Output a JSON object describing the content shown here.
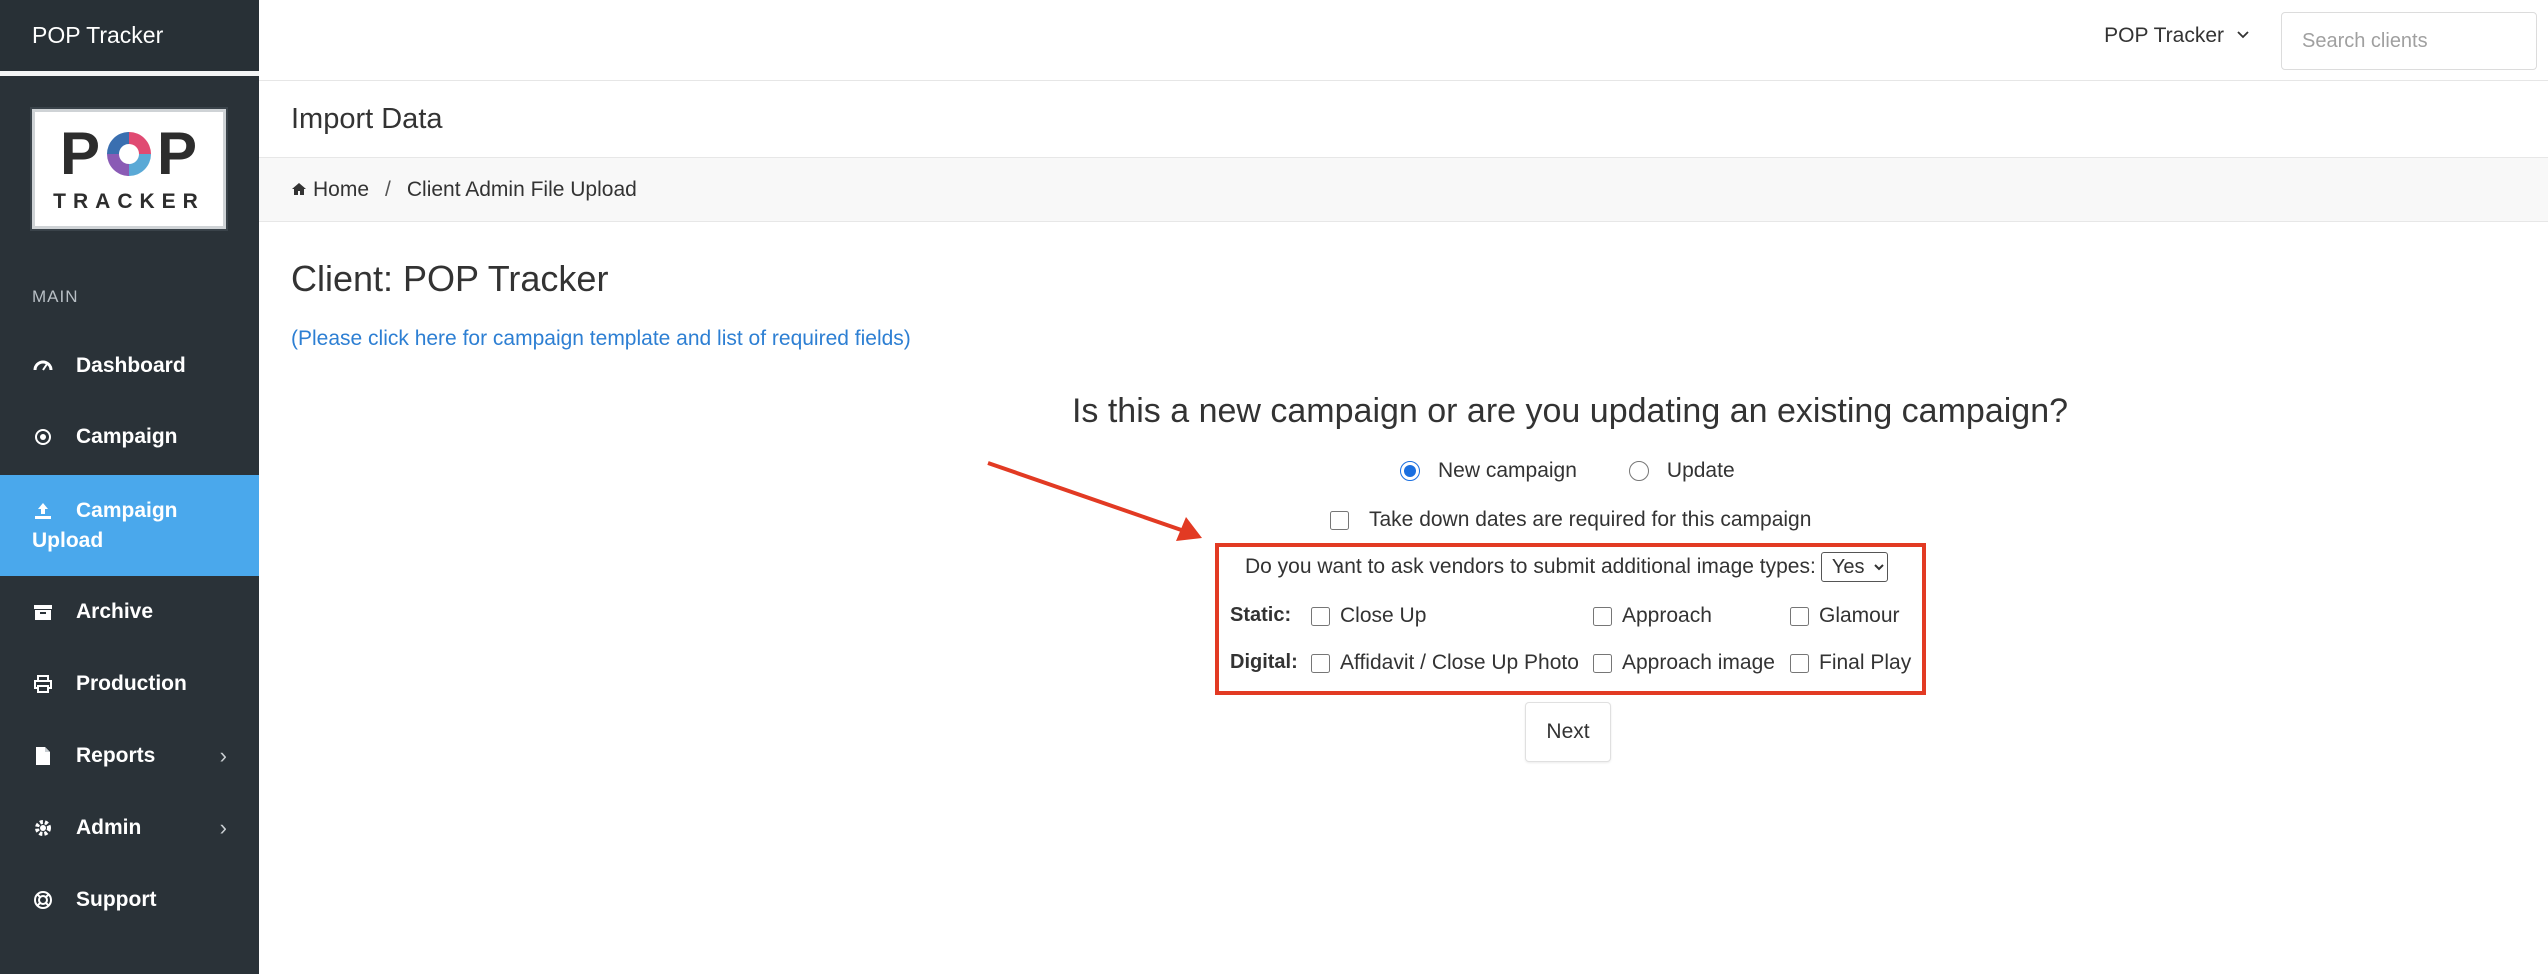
{
  "app": {
    "title": "POP Tracker"
  },
  "logo": {
    "text_top": "POP",
    "text_bottom": "TRACKER"
  },
  "sidebar": {
    "section_label": "MAIN",
    "items": [
      {
        "label": "Dashboard",
        "icon": "dashboard-icon"
      },
      {
        "label": "Campaign",
        "icon": "target-icon"
      },
      {
        "label": "Campaign Upload",
        "label_line1": "Campaign",
        "label_line2": "Upload",
        "icon": "upload-icon",
        "active": true
      },
      {
        "label": "Archive",
        "icon": "archive-icon"
      },
      {
        "label": "Production",
        "icon": "print-icon"
      },
      {
        "label": "Reports",
        "icon": "file-icon",
        "has_submenu": true
      },
      {
        "label": "Admin",
        "icon": "gear-icon",
        "has_submenu": true
      },
      {
        "label": "Support",
        "icon": "lifebuoy-icon"
      }
    ],
    "submenu_chevron": "›"
  },
  "topbar": {
    "client_select_label": "POP Tracker",
    "search_placeholder": "Search clients"
  },
  "page": {
    "header": "Import Data",
    "breadcrumb": {
      "home": "Home",
      "separator": "/",
      "current": "Client Admin File Upload"
    },
    "client_title": "Client: POP Tracker",
    "template_link": "(Please click here for campaign template and list of required fields)",
    "question": "Is this a new campaign or are you updating an existing campaign?",
    "radios": {
      "new_campaign": "New campaign",
      "update": "Update",
      "selected": "new_campaign"
    },
    "takedown_label": "Take down dates are required for this campaign",
    "ask_vendors_label": "Do you want to ask vendors to submit additional image types:",
    "ask_vendors_value": "Yes",
    "static": {
      "label": "Static:",
      "options": [
        "Close Up",
        "Approach",
        "Glamour"
      ]
    },
    "digital": {
      "label": "Digital:",
      "options": [
        "Affidavit / Close Up Photo",
        "Approach image",
        "Final Play"
      ]
    },
    "next_button": "Next"
  },
  "colors": {
    "sidebar_bg": "#2a3238",
    "active_item": "#4aa8ec",
    "link": "#2d7fd3",
    "annotation_red": "#e23a23"
  }
}
